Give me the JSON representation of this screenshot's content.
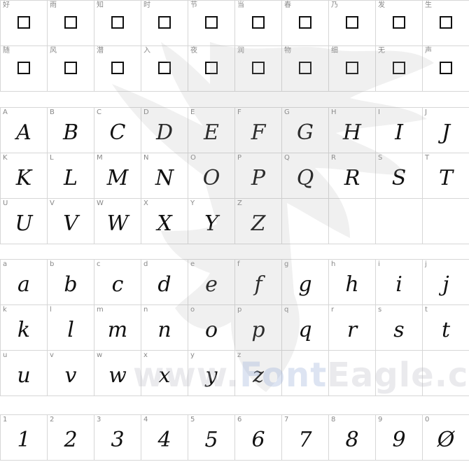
{
  "chinese": {
    "chars": [
      "好",
      "雨",
      "知",
      "时",
      "节",
      "当",
      "春",
      "乃",
      "发",
      "生",
      "随",
      "风",
      "潜",
      "入",
      "夜",
      "润",
      "物",
      "细",
      "无",
      "声"
    ]
  },
  "uppercase": {
    "labels": [
      "A",
      "B",
      "C",
      "D",
      "E",
      "F",
      "G",
      "H",
      "I",
      "J",
      "K",
      "L",
      "M",
      "N",
      "O",
      "P",
      "Q",
      "R",
      "S",
      "T",
      "U",
      "V",
      "W",
      "X",
      "Y",
      "Z"
    ],
    "glyphs": [
      "A",
      "B",
      "C",
      "D",
      "E",
      "F",
      "G",
      "H",
      "I",
      "J",
      "K",
      "L",
      "M",
      "N",
      "O",
      "P",
      "Q",
      "R",
      "S",
      "T",
      "U",
      "V",
      "W",
      "X",
      "Y",
      "Z"
    ]
  },
  "lowercase": {
    "labels": [
      "a",
      "b",
      "c",
      "d",
      "e",
      "f",
      "g",
      "h",
      "i",
      "j",
      "k",
      "l",
      "m",
      "n",
      "o",
      "p",
      "q",
      "r",
      "s",
      "t",
      "u",
      "v",
      "w",
      "x",
      "y",
      "z"
    ],
    "glyphs": [
      "a",
      "b",
      "c",
      "d",
      "e",
      "f",
      "g",
      "h",
      "i",
      "j",
      "k",
      "l",
      "m",
      "n",
      "o",
      "p",
      "q",
      "r",
      "s",
      "t",
      "u",
      "v",
      "w",
      "x",
      "y",
      "z"
    ]
  },
  "digits": {
    "labels": [
      "1",
      "2",
      "3",
      "4",
      "5",
      "6",
      "7",
      "8",
      "9",
      "0"
    ],
    "glyphs": [
      "1",
      "2",
      "3",
      "4",
      "5",
      "6",
      "7",
      "8",
      "9",
      "Ø"
    ]
  },
  "watermark": {
    "prefix": "www.",
    "brand_a": "Font",
    "brand_b": "Eagle",
    "suffix": ".com",
    "icon": "eagle-icon"
  }
}
